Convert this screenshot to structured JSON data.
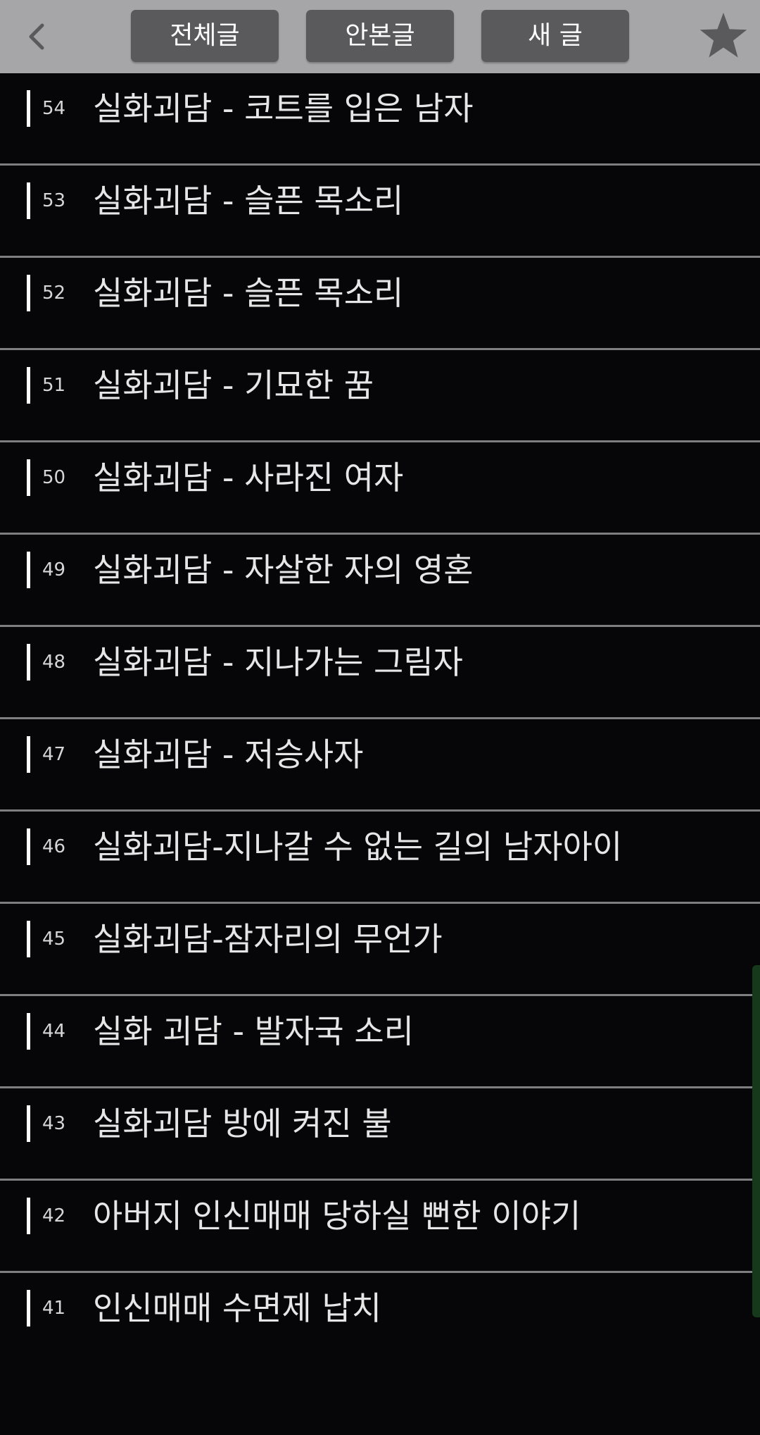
{
  "header": {
    "tabs": [
      {
        "label": "전체글"
      },
      {
        "label": "안본글"
      },
      {
        "label": "새 글"
      }
    ],
    "back_icon": "chevron-left-icon",
    "favorite_icon": "star-icon"
  },
  "posts": [
    {
      "num": "54",
      "title": "실화괴담 - 코트를 입은 남자"
    },
    {
      "num": "53",
      "title": "실화괴담 - 슬픈 목소리"
    },
    {
      "num": "52",
      "title": "실화괴담 - 슬픈 목소리"
    },
    {
      "num": "51",
      "title": "실화괴담 - 기묘한 꿈"
    },
    {
      "num": "50",
      "title": "실화괴담 - 사라진 여자"
    },
    {
      "num": "49",
      "title": "실화괴담 - 자살한 자의 영혼"
    },
    {
      "num": "48",
      "title": "실화괴담 - 지나가는 그림자"
    },
    {
      "num": "47",
      "title": "실화괴담 - 저승사자"
    },
    {
      "num": "46",
      "title": "실화괴담-지나갈 수 없는 길의 남자아이"
    },
    {
      "num": "45",
      "title": "실화괴담-잠자리의 무언가"
    },
    {
      "num": "44",
      "title": "실화 괴담 - 발자국 소리"
    },
    {
      "num": "43",
      "title": "실화괴담 방에 켜진 불"
    },
    {
      "num": "42",
      "title": "아버지 인신매매 당하실 뻔한 이야기"
    },
    {
      "num": "41",
      "title": "인신매매 수면제 납치"
    }
  ],
  "colors": {
    "background": "#060507",
    "header": "#a6a5a7",
    "tab": "#5a595b",
    "divider": "#7e7d80",
    "text": "#e6e6e6"
  }
}
